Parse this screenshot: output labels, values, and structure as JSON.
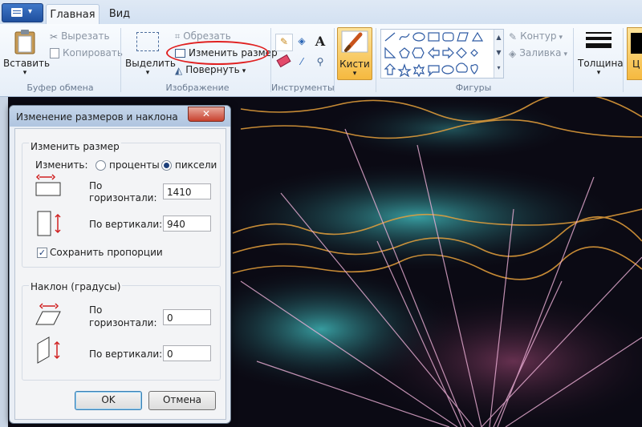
{
  "ribbon": {
    "tabs": [
      "Главная",
      "Вид"
    ],
    "clipboard": {
      "paste": "Вставить",
      "cut": "Вырезать",
      "copy": "Копировать",
      "label": "Буфер обмена"
    },
    "image": {
      "select": "Выделить",
      "crop": "Обрезать",
      "resize": "Изменить размер",
      "rotate": "Повернуть",
      "label": "Изображение"
    },
    "tools": {
      "label": "Инструменты"
    },
    "brushes": {
      "label": "Кисти"
    },
    "shapes": {
      "label": "Фигуры",
      "outline": "Контур",
      "fill": "Заливка"
    },
    "size": {
      "label": "Толщина"
    },
    "color_partial": "Ц"
  },
  "dialog": {
    "title": "Изменение размеров и наклона",
    "close": "✕",
    "resize": {
      "legend": "Изменить размер",
      "by_label": "Изменить:",
      "percent": "проценты",
      "pixels": "пиксели",
      "pixels_selected": true,
      "h_label_1": "По",
      "h_label_2": "горизонтали:",
      "h_value": "1410",
      "v_label": "По вертикали:",
      "v_value": "940",
      "keep_ratio": "Сохранить пропорции",
      "keep_ratio_checked": true
    },
    "skew": {
      "legend": "Наклон (градусы)",
      "h_label_1": "По",
      "h_label_2": "горизонтали:",
      "h_value": "0",
      "v_label": "По вертикали:",
      "v_value": "0"
    },
    "ok": "OK",
    "cancel": "Отмена"
  },
  "colors": {
    "accent_red": "#e02020",
    "brush_active": "#f7c04a",
    "canvas_bg": "#0b0a14"
  }
}
